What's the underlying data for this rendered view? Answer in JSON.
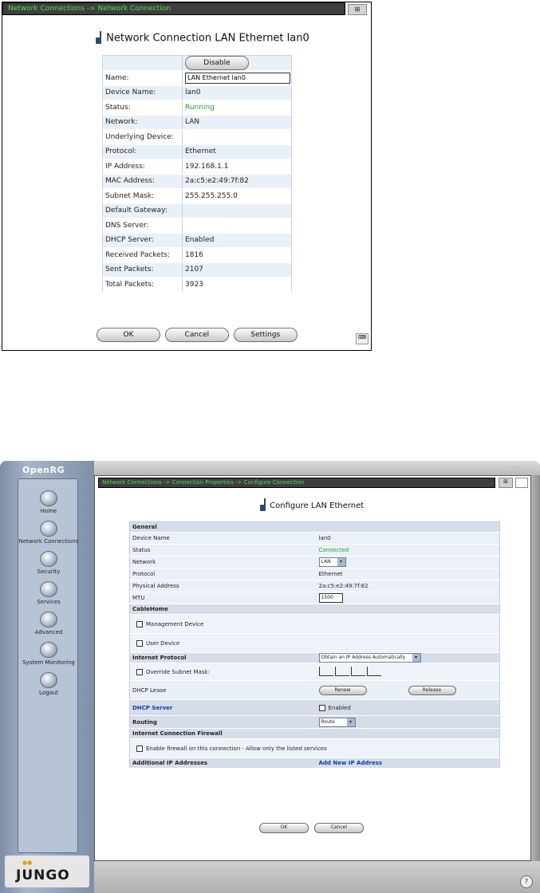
{
  "top": {
    "breadcrumb": "Network Connections -> Network Connection",
    "title": "Network Connection LAN Ethernet lan0",
    "disable_label": "Disable",
    "rows": [
      {
        "key": "Name:",
        "value": "LAN Ethernet lan0"
      },
      {
        "key": "Device Name:",
        "value": "lan0"
      },
      {
        "key": "Status:",
        "value": "Running"
      },
      {
        "key": "Network:",
        "value": "LAN"
      },
      {
        "key": "Underlying Device:",
        "value": ""
      },
      {
        "key": "Protocol:",
        "value": "Ethernet"
      },
      {
        "key": "IP Address:",
        "value": "192.168.1.1"
      },
      {
        "key": "MAC Address:",
        "value": "2a:c5:e2:49:7f:82"
      },
      {
        "key": "Subnet Mask:",
        "value": "255.255.255.0"
      },
      {
        "key": "Default Gateway:",
        "value": ""
      },
      {
        "key": "DNS Server:",
        "value": ""
      },
      {
        "key": "DHCP Server:",
        "value": "Enabled"
      },
      {
        "key": "Received Packets:",
        "value": "1816"
      },
      {
        "key": "Sent Packets:",
        "value": "2107"
      },
      {
        "key": "Total Packets:",
        "value": "3923"
      }
    ],
    "ok_label": "OK",
    "cancel_label": "Cancel",
    "settings_label": "Settings",
    "status_color": "#2a9d2a"
  },
  "bottom": {
    "logo": "OpenRG",
    "brand": "JUNGO",
    "sidebar": [
      "Home",
      "Network Connections",
      "Security",
      "Services",
      "Advanced",
      "System Monitoring",
      "Logout"
    ],
    "breadcrumb": "Network Connections -> Connection Properties -> Configure Connection",
    "title": "Configure LAN Ethernet",
    "general_header": "General",
    "device_name_label": "Device Name",
    "device_name_value": "lan0",
    "status_label": "Status",
    "status_value": "Connected",
    "network_label": "Network",
    "network_value": "LAN",
    "protocol_label": "Protocol",
    "protocol_value": "Ethernet",
    "mac_label": "Physical Address",
    "mac_value": "2a:c5:e2:49:7f:82",
    "mtu_label": "MTU",
    "mtu_value": "1500",
    "cablehome_header": "CableHome",
    "mgmt_device_label": "Management Device",
    "user_device_label": "User Device",
    "ip_label": "Internet Protocol",
    "ip_value": "Obtain an IP Address Automatically",
    "override_mask_label": "Override Subnet Mask:",
    "dhcp_lease_label": "DHCP Lease",
    "renew_label": "Renew",
    "release_label": "Release",
    "dhcp_server_label": "DHCP Server",
    "dhcp_server_value": "Enabled",
    "routing_label": "Routing",
    "routing_value": "Route",
    "firewall_header": "Internet Connection Firewall",
    "firewall_text": "Enable firewall on this connection - Allow only the listed services",
    "addl_ip_label": "Additional IP Addresses",
    "add_ip_link": "Add New IP Address",
    "ok_label": "OK",
    "cancel_label": "Cancel"
  }
}
